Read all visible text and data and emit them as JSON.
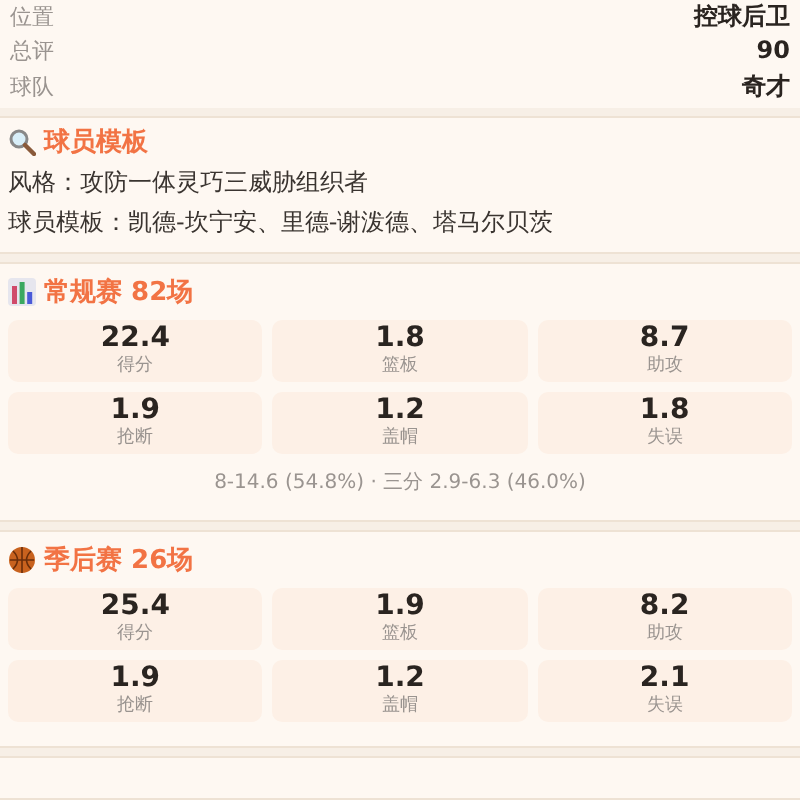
{
  "info_rows": [
    {
      "label": "位置",
      "value": "控球后卫"
    },
    {
      "label": "总评",
      "value": "90"
    },
    {
      "label": "球队",
      "value": "奇才"
    }
  ],
  "template": {
    "title": "球员模板",
    "lines": [
      "风格：攻防一体灵巧三威胁组织者",
      "球员模板：凯德-坎宁安、里德-谢泼德、塔马尔贝茨"
    ]
  },
  "sections": [
    {
      "kind": "regular",
      "title": "常规赛 82场",
      "stats": [
        {
          "value": "22.4",
          "label": "得分"
        },
        {
          "value": "1.8",
          "label": "篮板"
        },
        {
          "value": "8.7",
          "label": "助攻"
        },
        {
          "value": "1.9",
          "label": "抢断"
        },
        {
          "value": "1.2",
          "label": "盖帽"
        },
        {
          "value": "1.8",
          "label": "失误"
        }
      ],
      "shooting": "8-14.6 (54.8%) · 三分 2.9-6.3 (46.0%)"
    },
    {
      "kind": "playoff",
      "title": "季后赛 26场",
      "stats": [
        {
          "value": "25.4",
          "label": "得分"
        },
        {
          "value": "1.9",
          "label": "篮板"
        },
        {
          "value": "8.2",
          "label": "助攻"
        },
        {
          "value": "1.9",
          "label": "抢断"
        },
        {
          "value": "1.2",
          "label": "盖帽"
        },
        {
          "value": "2.1",
          "label": "失误"
        }
      ]
    }
  ]
}
